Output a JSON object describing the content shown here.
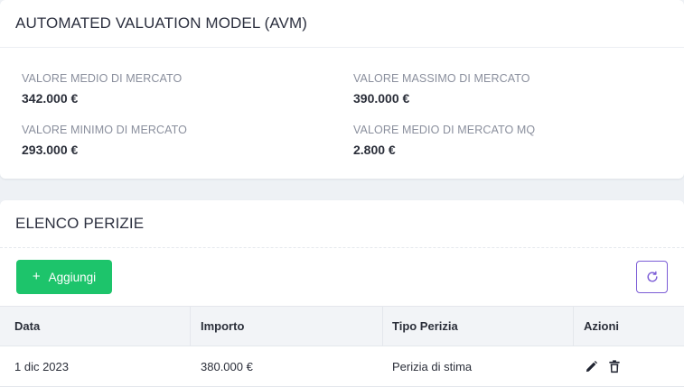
{
  "avm": {
    "title": "AUTOMATED VALUATION MODEL (AVM)",
    "metrics": [
      {
        "label": "VALORE MEDIO DI MERCATO",
        "value": "342.000 €"
      },
      {
        "label": "VALORE MASSIMO DI MERCATO",
        "value": "390.000 €"
      },
      {
        "label": "VALORE MINIMO DI MERCATO",
        "value": "293.000 €"
      },
      {
        "label": "VALORE MEDIO DI MERCATO MQ",
        "value": "2.800 €"
      }
    ]
  },
  "perizie": {
    "title": "ELENCO PERIZIE",
    "add_label": "Aggiungi",
    "add_icon": "+",
    "refresh_icon": "refresh-icon",
    "columns": [
      "Data",
      "Importo",
      "Tipo Perizia",
      "Azioni"
    ],
    "rows": [
      {
        "data": "1 dic 2023",
        "importo": "380.000 €",
        "tipo": "Perizia di stima"
      }
    ]
  },
  "colors": {
    "accent_green": "#1dc46b",
    "accent_purple": "#7b5cd6"
  }
}
